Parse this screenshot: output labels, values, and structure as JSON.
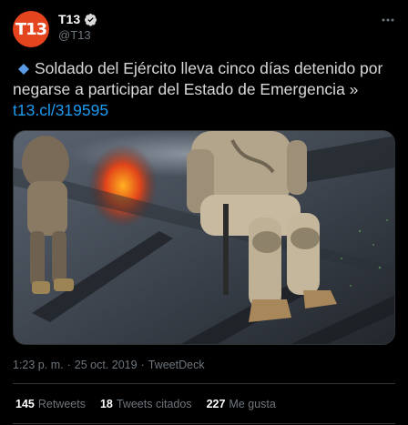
{
  "tweet": {
    "author": {
      "display_name": "T13",
      "handle": "@T13",
      "avatar_text": "T13",
      "avatar_color": "#e4441e",
      "verified": true
    },
    "text_main": "Soldado del Ejército lleva cinco días detenido por negarse a participar del Estado de Emergencia »",
    "link": "t13.cl/319595",
    "link_color": "#1d9bf0",
    "leading_icon": "blue-diamond-icon",
    "media": {
      "description_icon": "photo-image"
    },
    "meta": {
      "time": "1:23 p. m.",
      "separator": "·",
      "date": "25 oct. 2019",
      "source": "TweetDeck"
    },
    "stats": [
      {
        "count": "145",
        "label": "Retweets"
      },
      {
        "count": "18",
        "label": "Tweets citados"
      },
      {
        "count": "227",
        "label": "Me gusta"
      }
    ]
  }
}
